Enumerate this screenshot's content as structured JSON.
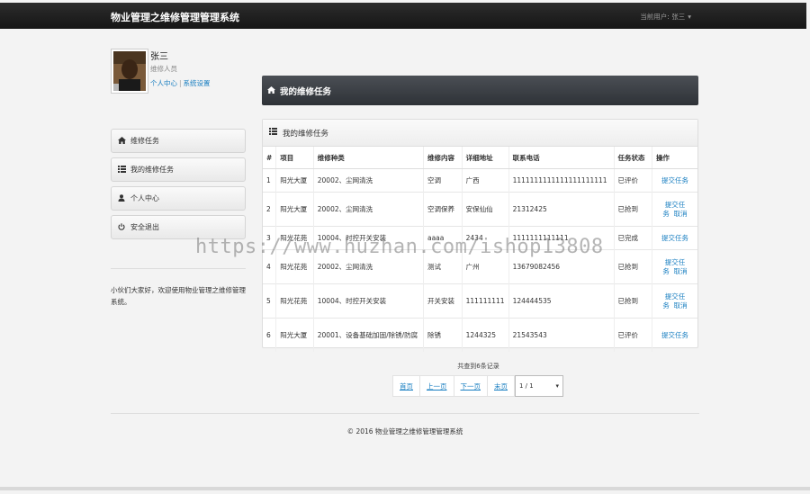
{
  "header": {
    "brand": "物业管理之维修管理管理系统",
    "current_user_label": "当前用户: 张三"
  },
  "profile": {
    "name": "张三",
    "role": "维修人员",
    "link_personal": "个人中心",
    "separator": "|",
    "link_settings": "系统设置"
  },
  "nav": [
    {
      "label": "维修任务",
      "icon": "home-icon"
    },
    {
      "label": "我的维修任务",
      "icon": "list-icon"
    },
    {
      "label": "个人中心",
      "icon": "user-icon"
    },
    {
      "label": "安全退出",
      "icon": "power-icon"
    }
  ],
  "welcome_text": "小伙们大家好，欢迎使用物业管理之维修管理系统。",
  "page_title": "我的维修任务",
  "panel_title": "我的维修任务",
  "table": {
    "headers": [
      "#",
      "项目",
      "维修种类",
      "维修内容",
      "详细地址",
      "联系电话",
      "任务状态",
      "操作"
    ],
    "rows": [
      {
        "no": "1",
        "project": "阳光大厦",
        "type": "20002、尘网清洗",
        "content": "空调",
        "address": "广西",
        "phone": "1111111111111111111111",
        "status": "已评价",
        "ops": [
          "提交任务"
        ]
      },
      {
        "no": "2",
        "project": "阳光大厦",
        "type": "20002、尘网清洗",
        "content": "空调保养",
        "address": "安保仙仙",
        "phone": "21312425",
        "status": "已抢到",
        "ops": [
          "提交任务",
          "取消"
        ]
      },
      {
        "no": "3",
        "project": "阳光花苑",
        "type": "10004、时控开关安装",
        "content": "aaaa",
        "address": "2434",
        "phone": "1111111111111",
        "status": "已完成",
        "ops": [
          "提交任务"
        ]
      },
      {
        "no": "4",
        "project": "阳光花苑",
        "type": "20002、尘网清洗",
        "content": "测试",
        "address": "广州",
        "phone": "13679082456",
        "status": "已抢到",
        "ops": [
          "提交任务",
          "取消"
        ]
      },
      {
        "no": "5",
        "project": "阳光花苑",
        "type": "10004、时控开关安装",
        "content": "开关安装",
        "address": "111111111",
        "phone": "124444535",
        "status": "已抢到",
        "ops": [
          "提交任务",
          "取消"
        ]
      },
      {
        "no": "6",
        "project": "阳光大厦",
        "type": "20001、设备基础加固/除锈/防腐",
        "content": "除锈",
        "address": "1244325",
        "phone": "21543543",
        "status": "已评价",
        "ops": [
          "提交任务"
        ]
      }
    ]
  },
  "pager": {
    "info": "共查到6条记录",
    "first": "首页",
    "prev": "上一页",
    "next": "下一页",
    "last": "末页",
    "select_value": "1 / 1"
  },
  "footer": "© 2016 物业管理之维修管理管理系统",
  "watermark": "https://www.huzhan.com/ishop13808"
}
